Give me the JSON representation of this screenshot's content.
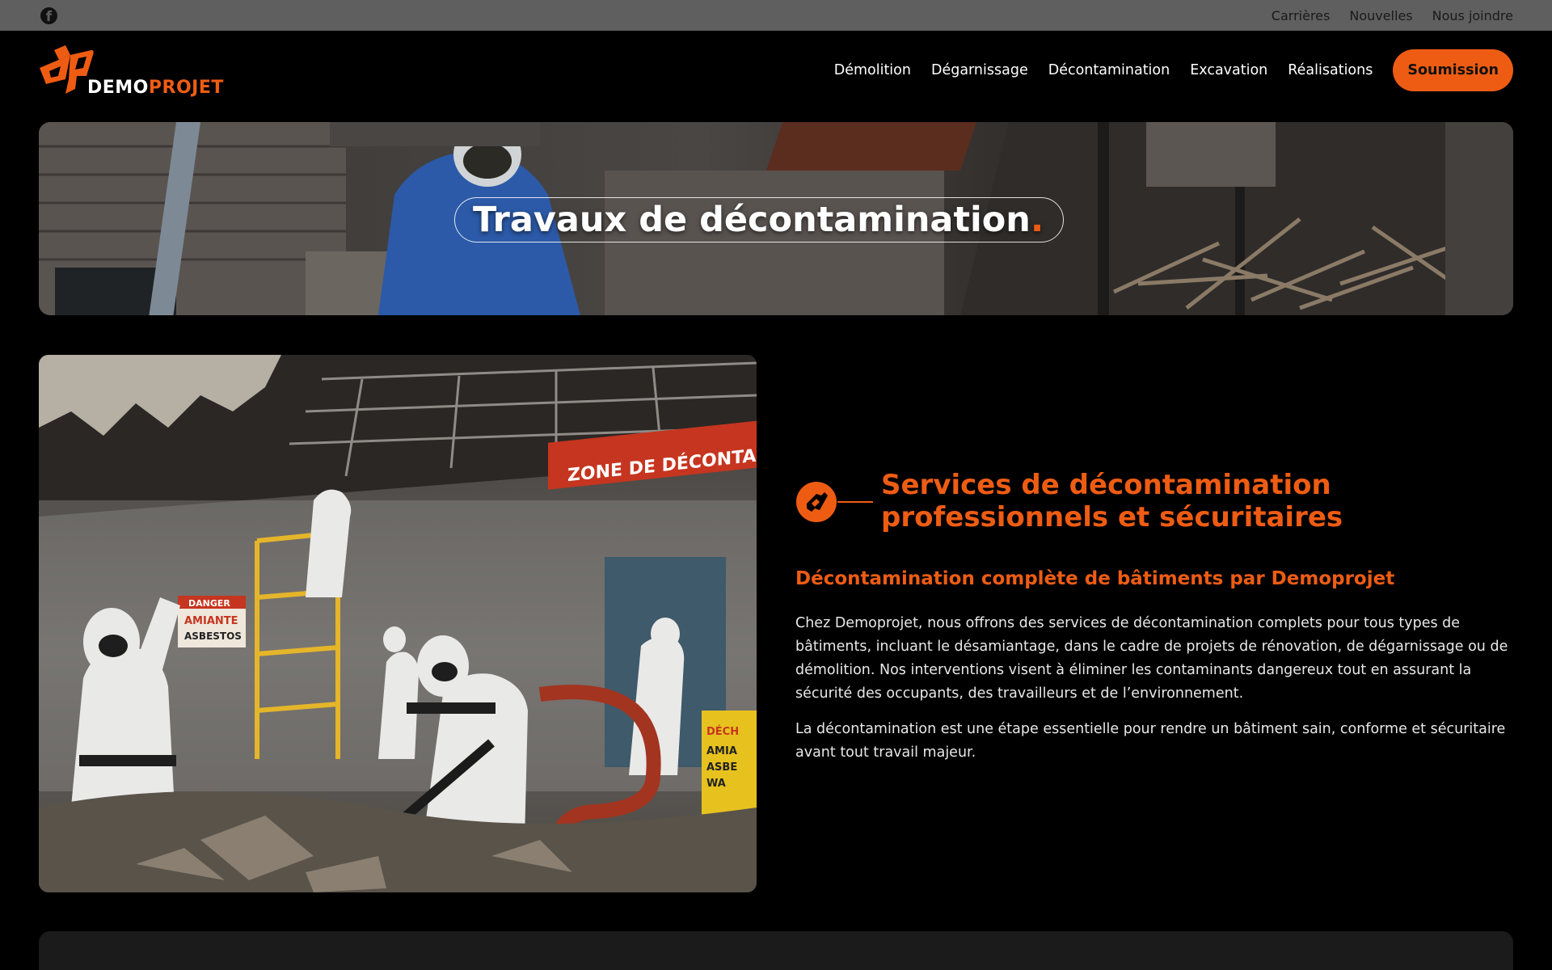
{
  "topbar": {
    "social_icon": "facebook-icon",
    "links": [
      "Carrières",
      "Nouvelles",
      "Nous joindre"
    ]
  },
  "header": {
    "logo_icon": "dp-logo-icon",
    "logo_word_1": "DEMO",
    "logo_word_2": "PROJET",
    "nav": [
      "Démolition",
      "Dégarnissage",
      "Décontamination",
      "Excavation",
      "Réalisations"
    ],
    "cta_label": "Soumission"
  },
  "hero": {
    "title": "Travaux de décontamination",
    "title_dot": "."
  },
  "section": {
    "icon": "dp-badge-icon",
    "title": "Services de décontamination professionnels et sécuritaires",
    "subtitle": "Décontamination complète de bâtiments par Demoprojet",
    "paragraph_1": "Chez Demoprojet, nous offrons des services de décontamination complets pour tous types de bâtiments, incluant le désamiantage, dans le cadre de projets de rénovation, de dégarnissage ou de démolition. Nos interventions visent à éliminer les contaminants dangereux tout en assurant la sécurité des occupants, des travailleurs et de l’environnement.",
    "paragraph_2": "La décontamination est une étape essentielle pour rendre un bâtiment sain, conforme et sécuritaire avant tout travail majeur."
  },
  "photo_signs": {
    "zone": "ZONE DE DÉCONTAMINATIO",
    "danger": "DANGER",
    "amiante": "AMIANTE",
    "asbestos": "ASBESTOS",
    "bin_1": "DÉCH",
    "bin_2": "AMIA",
    "bin_3": "ASBE",
    "bin_4": "WA"
  },
  "colors": {
    "accent": "#ee5c13",
    "background": "#000000",
    "topbar": "#5f5f5f"
  }
}
